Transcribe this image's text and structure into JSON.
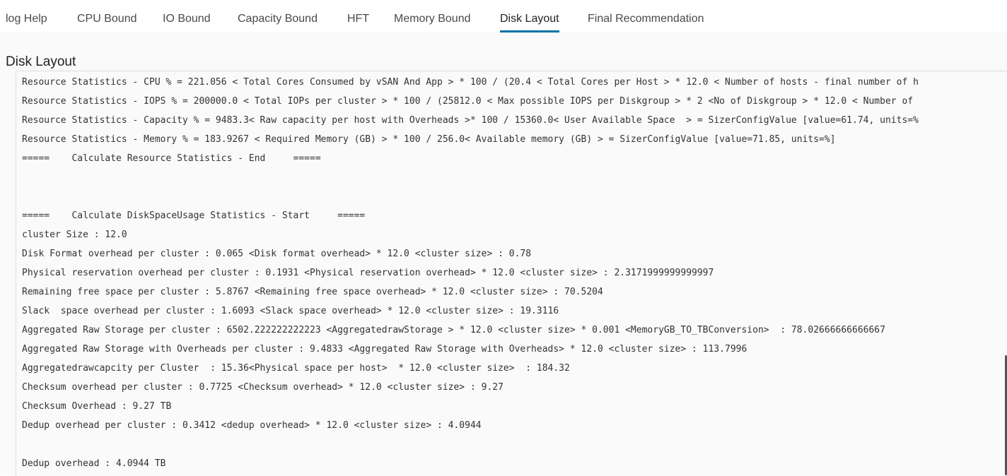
{
  "tabs": [
    {
      "label": "log Help",
      "active": false
    },
    {
      "label": "CPU Bound",
      "active": false
    },
    {
      "label": "IO Bound",
      "active": false
    },
    {
      "label": "Capacity Bound",
      "active": false
    },
    {
      "label": "HFT",
      "active": false
    },
    {
      "label": "Memory Bound",
      "active": false
    },
    {
      "label": "Disk Layout",
      "active": true
    },
    {
      "label": "Final Recommendation",
      "active": false
    }
  ],
  "section": {
    "title": "Disk Layout"
  },
  "log": {
    "lines": [
      "Resource Statistics - CPU % = 221.056 < Total Cores Consumed by vSAN And App > * 100 / (20.4 < Total Cores per Host > * 12.0 < Number of hosts - final number of h",
      "Resource Statistics - IOPS % = 200000.0 < Total IOPs per cluster > * 100 / (25812.0 < Max possible IOPS per Diskgroup > * 2 <No of Diskgroup > * 12.0 < Number of",
      "Resource Statistics - Capacity % = 9483.3< Raw capacity per host with Overheads >* 100 / 15360.0< User Available Space  > = SizerConfigValue [value=61.74, units=%",
      "Resource Statistics - Memory % = 183.9267 < Required Memory (GB) > * 100 / 256.0< Available memory (GB) > = SizerConfigValue [value=71.85, units=%]",
      "=====    Calculate Resource Statistics - End     =====",
      "",
      "",
      "=====    Calculate DiskSpaceUsage Statistics - Start     =====",
      "cluster Size : 12.0",
      "Disk Format overhead per cluster : 0.065 <Disk format overhead> * 12.0 <cluster size> : 0.78",
      "Physical reservation overhead per cluster : 0.1931 <Physical reservation overhead> * 12.0 <cluster size> : 2.3171999999999997",
      "Remaining free space per cluster : 5.8767 <Remaining free space overhead> * 12.0 <cluster size> : 70.5204",
      "Slack  space overhead per cluster : 1.6093 <Slack space overhead> * 12.0 <cluster size> : 19.3116",
      "Aggregated Raw Storage per cluster : 6502.222222222223 <AggregatedrawStorage > * 12.0 <cluster size> * 0.001 <MemoryGB_TO_TBConversion>  : 78.02666666666667",
      "Aggregated Raw Storage with Overheads per cluster : 9.4833 <Aggregated Raw Storage with Overheads> * 12.0 <cluster size> : 113.7996",
      "Aggregatedrawcapcity per Cluster  : 15.36<Physical space per host>  * 12.0 <cluster size>  : 184.32",
      "Checksum overhead per cluster : 0.7725 <Checksum overhead> * 12.0 <cluster size> : 9.27",
      "Checksum Overhead : 9.27 TB",
      "Dedup overhead per cluster : 0.3412 <dedup overhead> * 12.0 <cluster size> : 4.0944",
      "",
      "Dedup overhead : 4.0944 TB"
    ]
  }
}
